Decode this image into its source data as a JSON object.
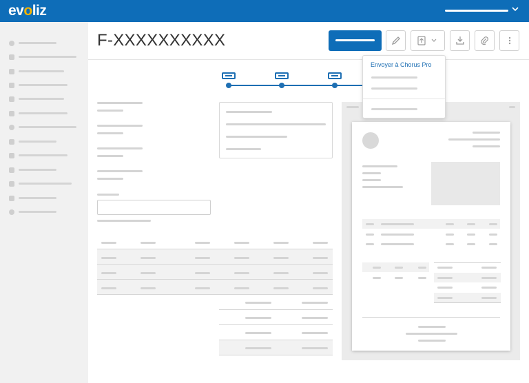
{
  "app": {
    "logo_text_pre": "ev",
    "logo_text_accent": "o",
    "logo_text_post": "liz",
    "brand_color": "#0e6db8",
    "accent_color": "#f5b400"
  },
  "header": {
    "user_menu_icon": "chevron-down-icon"
  },
  "sidebar": {
    "items": [
      {
        "icon": "dashboard-icon"
      },
      {
        "icon": "documents-icon"
      },
      {
        "icon": "megaphone-icon"
      },
      {
        "icon": "briefcase-icon"
      },
      {
        "icon": "tag-icon"
      },
      {
        "icon": "cart-icon"
      },
      {
        "icon": "user-icon"
      },
      {
        "icon": "bank-icon"
      },
      {
        "icon": "file-icon"
      },
      {
        "icon": "chart-icon"
      },
      {
        "icon": "calculator-icon"
      },
      {
        "icon": "inbox-icon"
      },
      {
        "icon": "settings-icon"
      }
    ]
  },
  "document": {
    "title": "F-XXXXXXXXXX"
  },
  "toolbar": {
    "icons": [
      "pencil-icon",
      "upload-icon",
      "chevron-down-icon",
      "download-icon",
      "paperclip-icon",
      "more-vertical-icon"
    ]
  },
  "dropdown": {
    "item_chorus": "Envoyer à Chorus Pro"
  },
  "stepper": {
    "steps_total": 4,
    "steps_active": 3
  }
}
